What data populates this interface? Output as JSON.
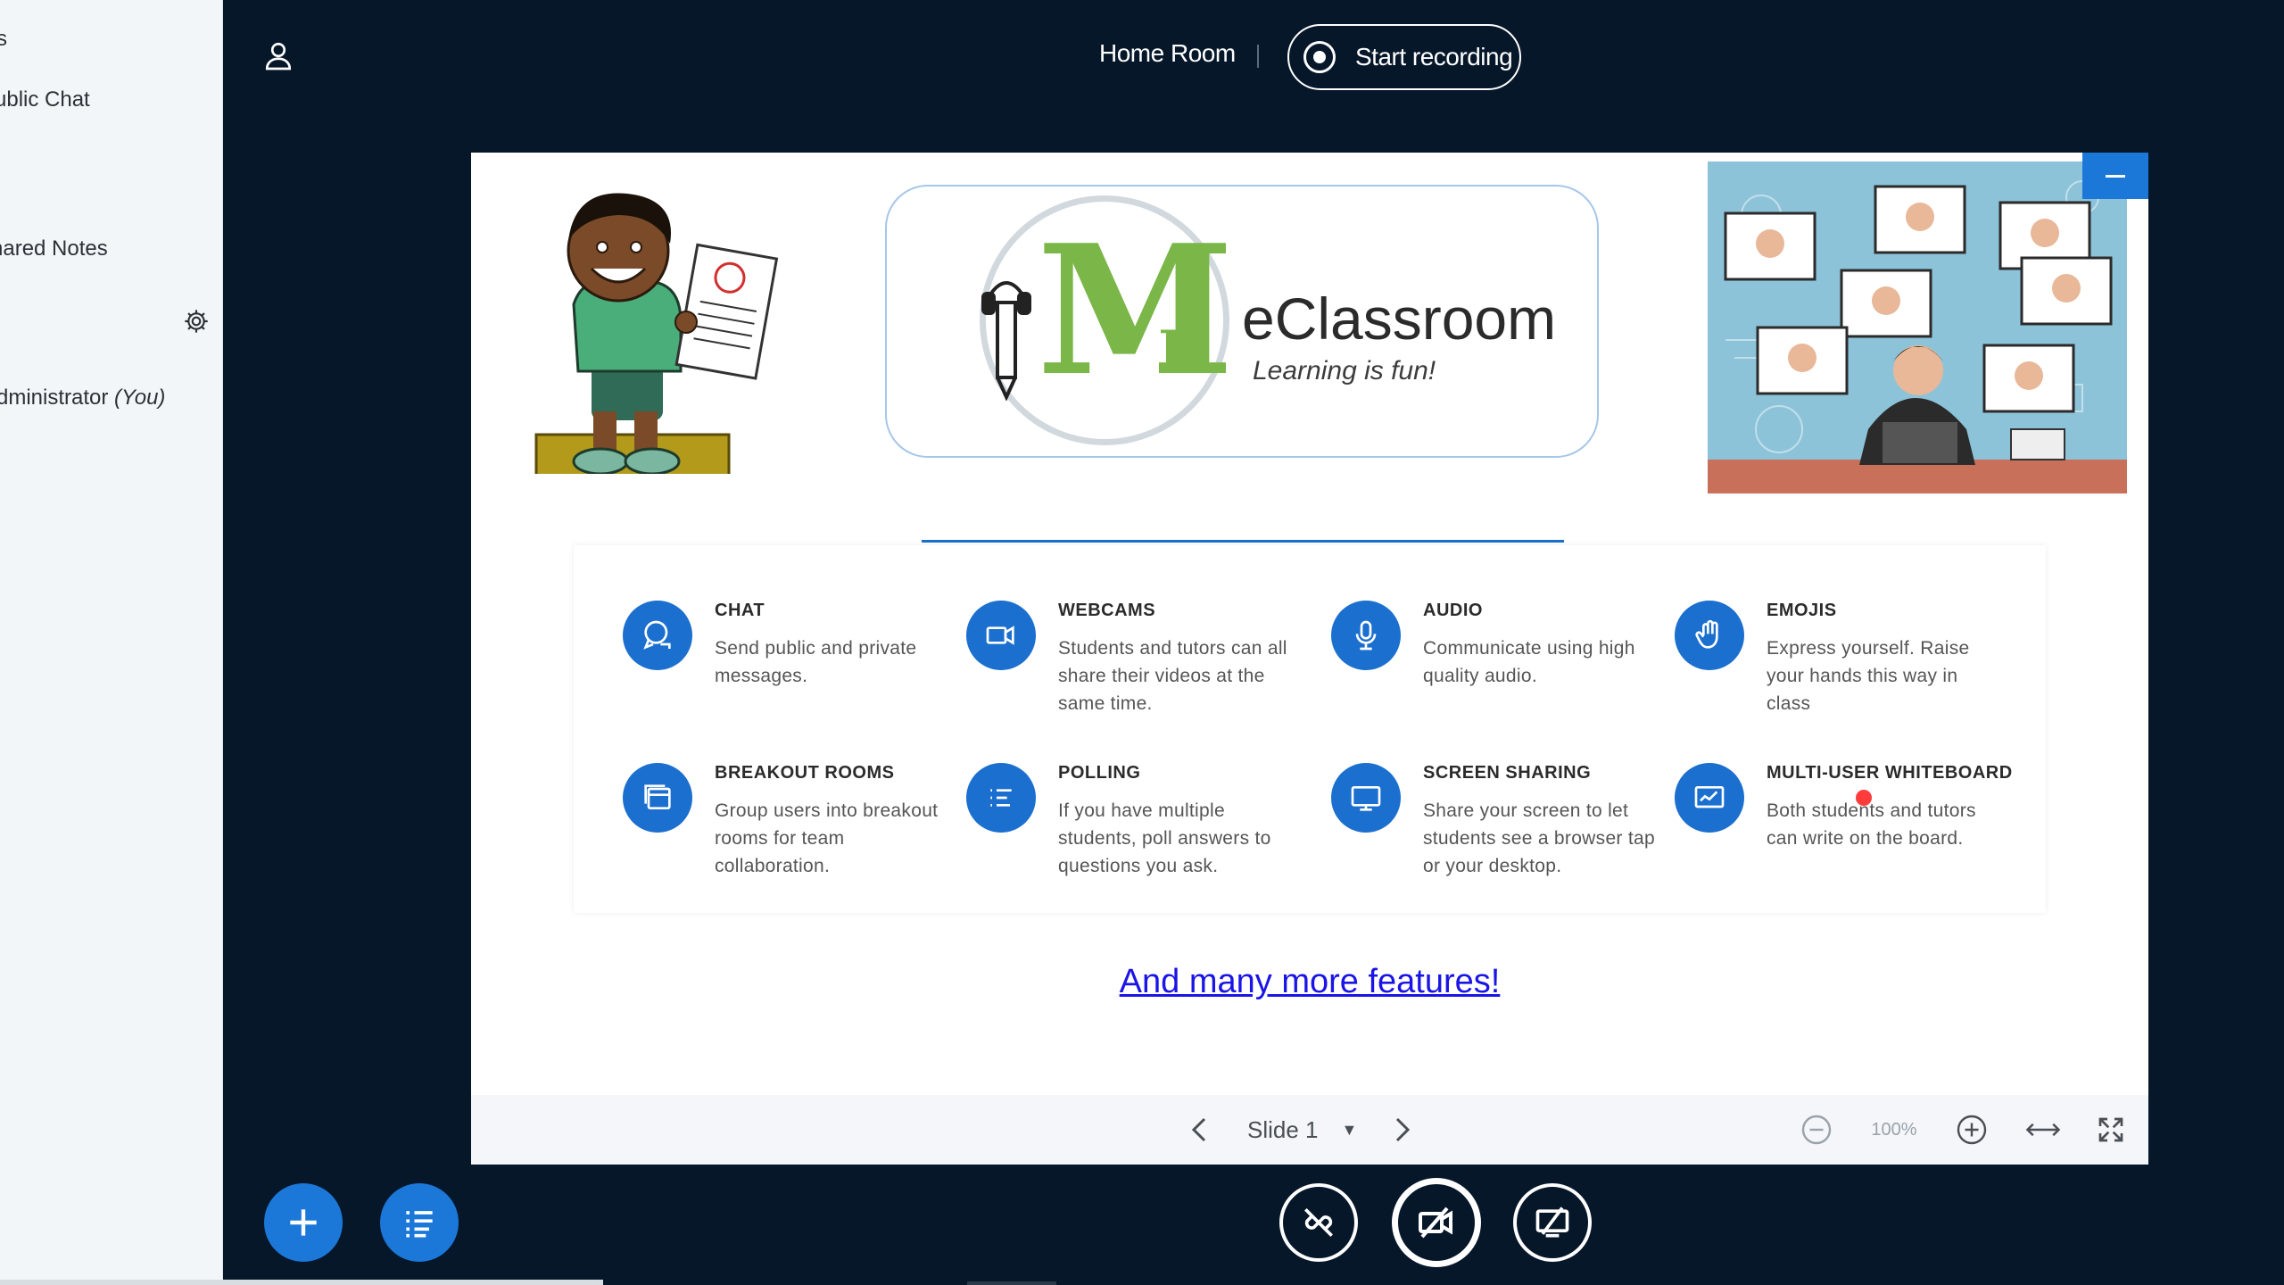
{
  "sidebar": {
    "top_label": "s",
    "public_chat": "ublic Chat",
    "shared_notes": "hared Notes",
    "user_name": "dministrator",
    "user_suffix": "(You)"
  },
  "header": {
    "room_title": "Home Room",
    "record_label": "Start recording"
  },
  "slide": {
    "logo_title": "eClassroom",
    "logo_tagline": "Learning is fun!",
    "features": [
      {
        "title": "CHAT",
        "desc": "Send public and private messages.",
        "icon": "chat-icon"
      },
      {
        "title": "WEBCAMS",
        "desc": "Students and tutors can all share their videos at the same time.",
        "icon": "video-icon"
      },
      {
        "title": "AUDIO",
        "desc": "Communicate using high quality audio.",
        "icon": "microphone-icon"
      },
      {
        "title": "EMOJIS",
        "desc": "Express yourself. Raise your hands this way in class",
        "icon": "hand-icon"
      },
      {
        "title": "BREAKOUT ROOMS",
        "desc": "Group users into breakout rooms for team collaboration.",
        "icon": "breakout-icon"
      },
      {
        "title": "POLLING",
        "desc": "If you have multiple students, poll answers to questions you ask.",
        "icon": "poll-icon"
      },
      {
        "title": "SCREEN SHARING",
        "desc": "Share your screen to let students see a browser tap or your desktop.",
        "icon": "screen-icon"
      },
      {
        "title": "MULTI-USER WHITEBOARD",
        "desc": "Both students and tutors can write on the board.",
        "icon": "whiteboard-icon"
      }
    ],
    "more_link": "And many more features!"
  },
  "toolbar": {
    "slide_label": "Slide 1",
    "zoom_level": "100%"
  },
  "colors": {
    "background": "#06172a",
    "accent": "#1b78d8",
    "logo_green": "#7ab648",
    "link": "#1a14e6"
  }
}
